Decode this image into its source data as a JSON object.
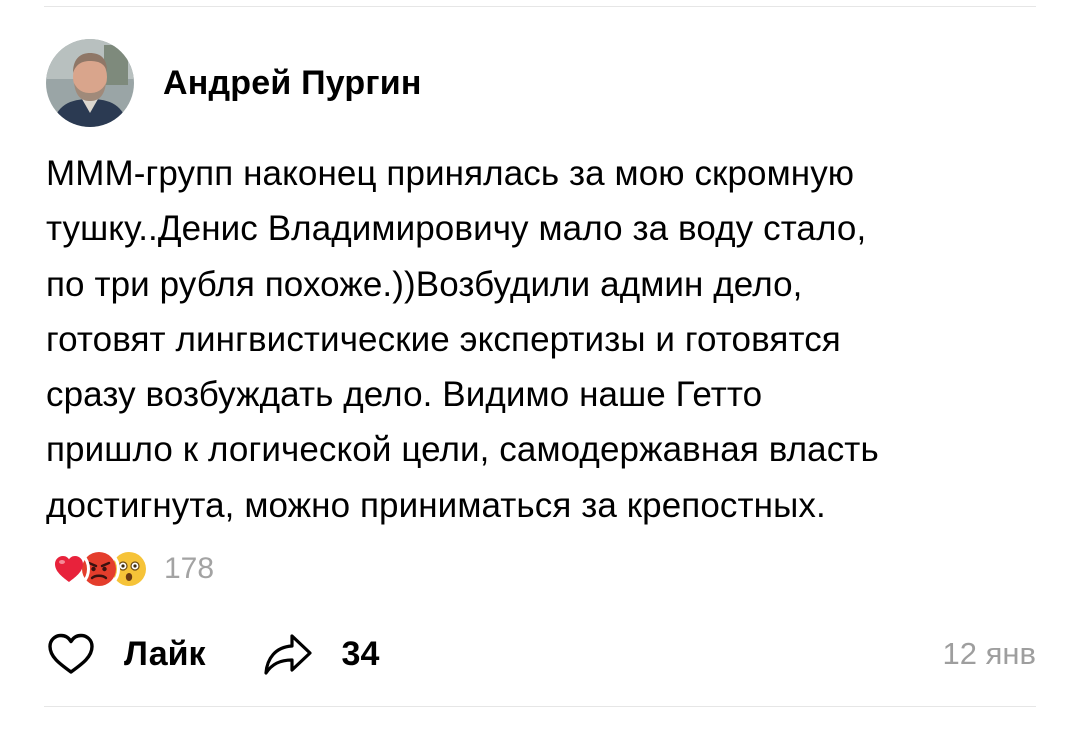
{
  "post": {
    "author": "Андрей Пургин",
    "text": "МММ-групп наконец принялась за мою скромную\nтушку..Денис Владимировичу мало за воду стало,\nпо три рубля похоже.))Возбудили админ дело,\nготовят лингвистические экспертизы и готовятся\nсразу возбуждать дело. Видимо наше Гетто\nпришло к логической цели, самодержавная власть\nдостигнута, можно приниматься за крепостных.",
    "date": "12 янв"
  },
  "reactions": {
    "icons": [
      "heart-emoji",
      "angry-face-emoji",
      "astonished-face-emoji"
    ],
    "count": "178"
  },
  "actions": {
    "like_label": "Лайк",
    "share_count": "34"
  },
  "colors": {
    "muted": "#9e9e9e",
    "heart": "#e8223b",
    "angry": "#e43d2c",
    "astonished": "#f6c338"
  }
}
